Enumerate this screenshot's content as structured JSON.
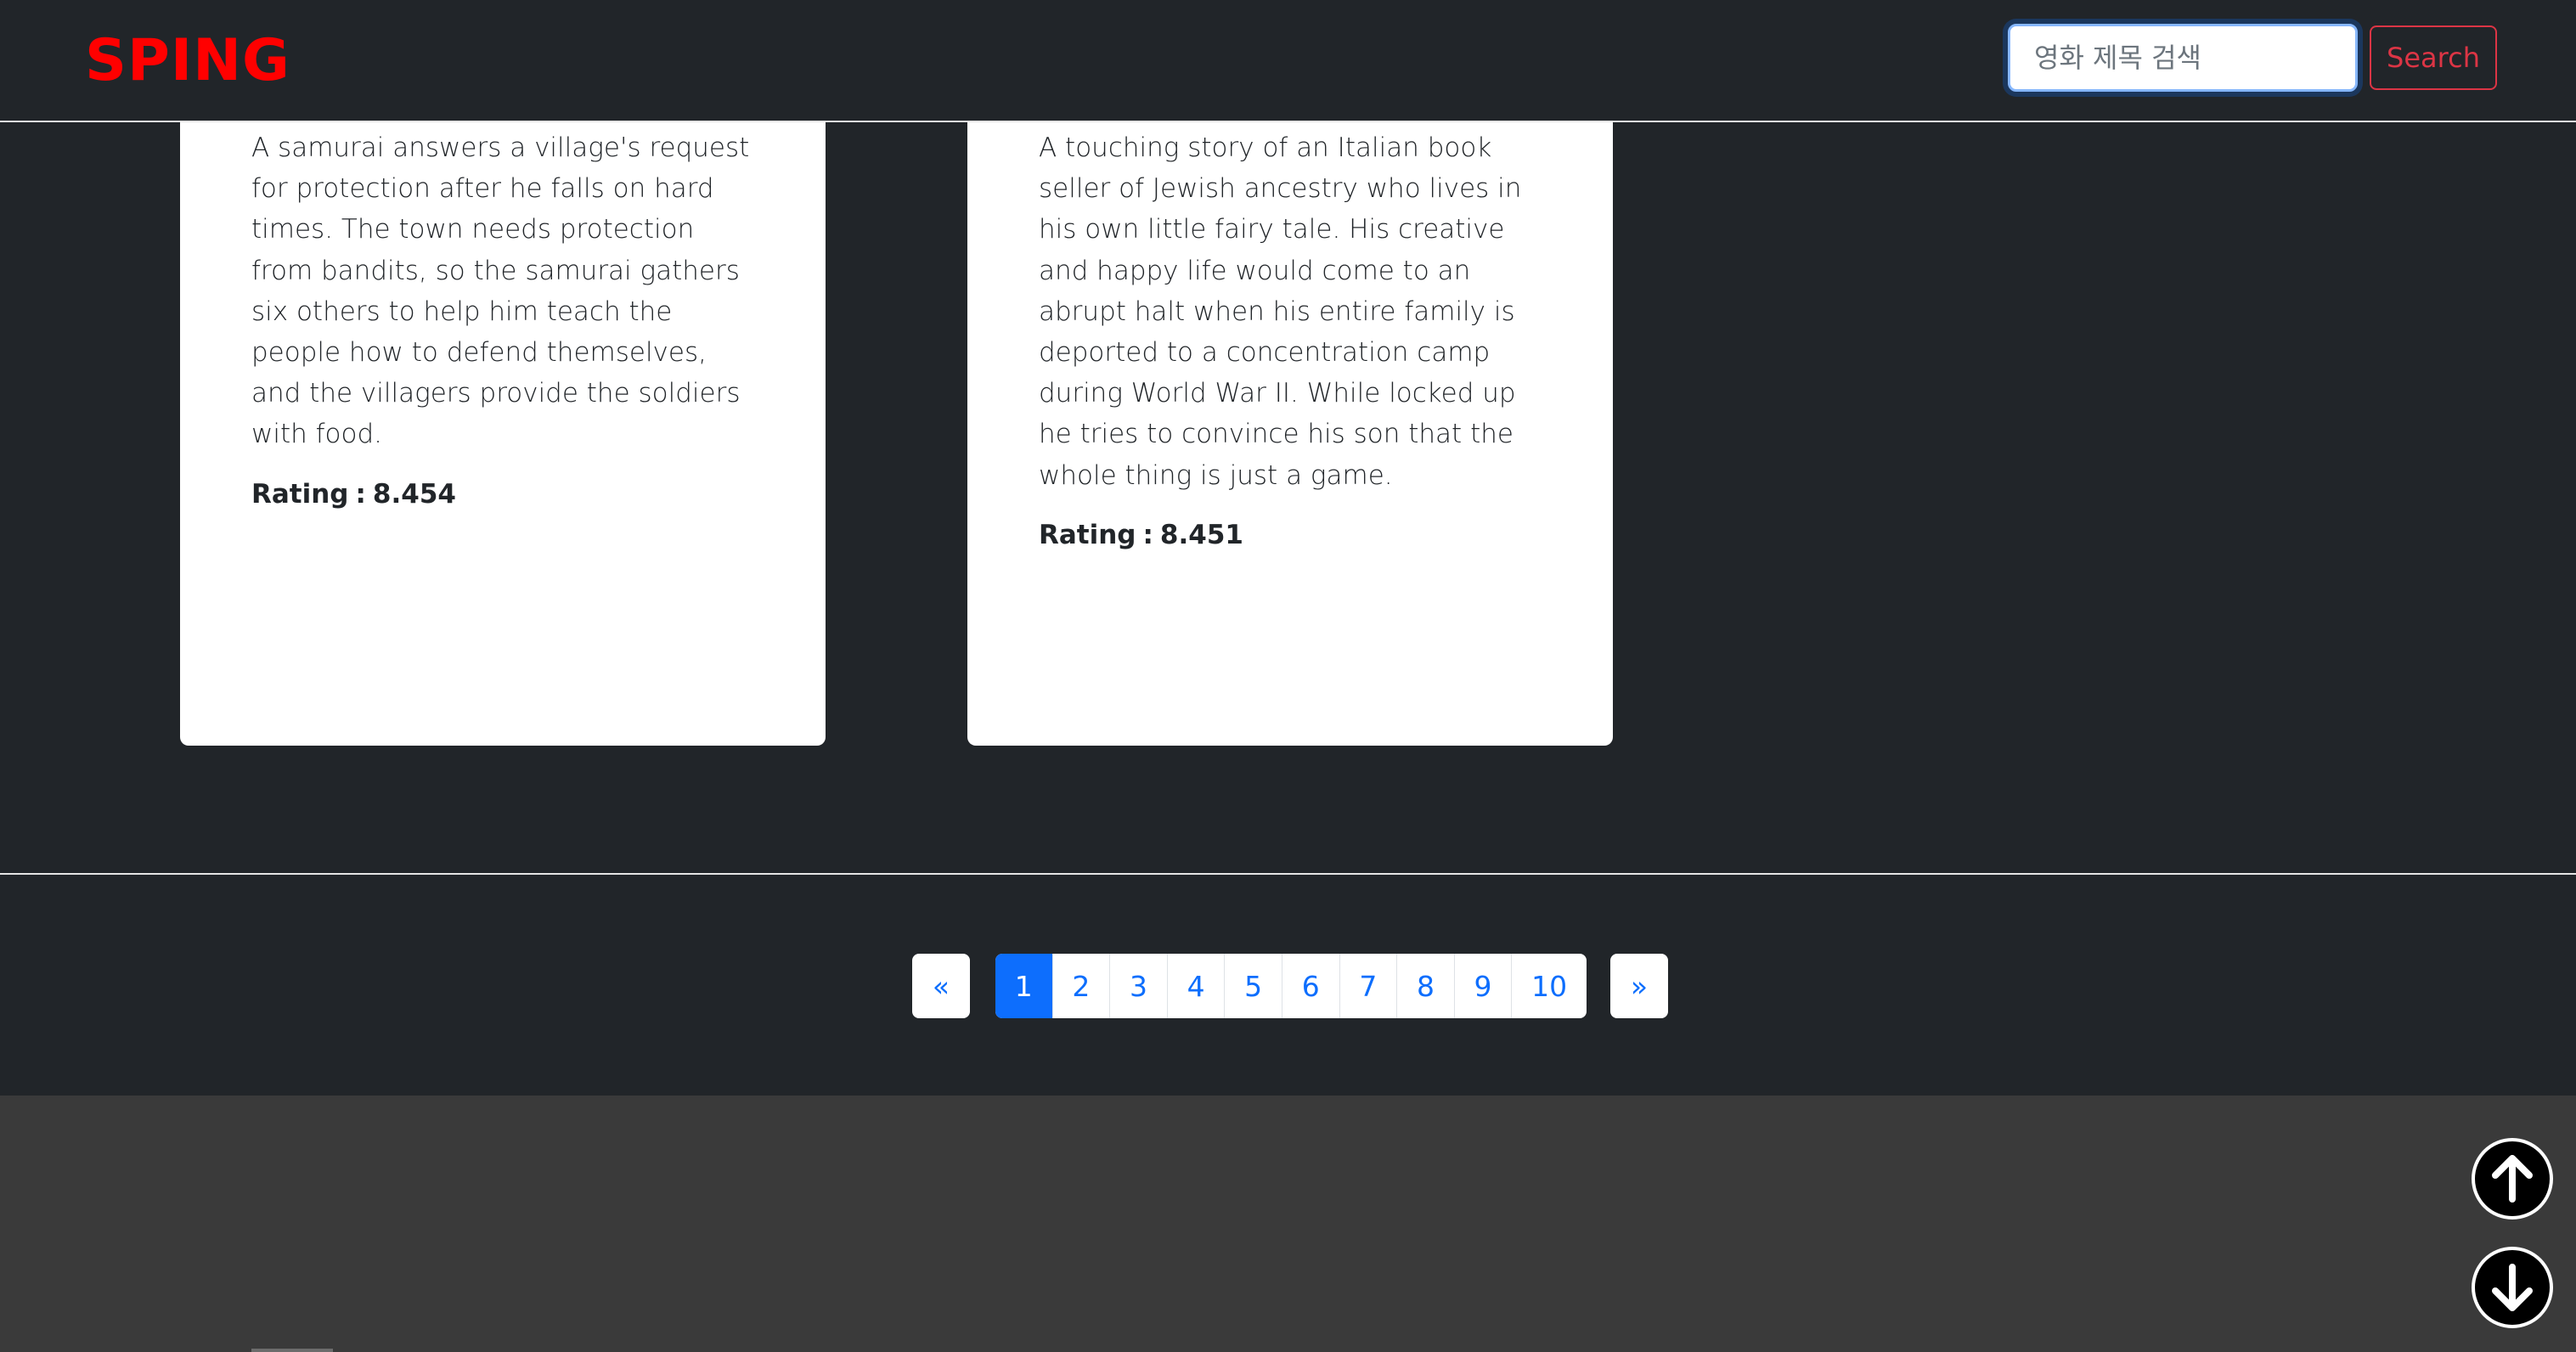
{
  "navbar": {
    "brand": "SPING",
    "search_placeholder": "영화 제목 검색",
    "search_value": "",
    "search_button": "Search"
  },
  "movies": [
    {
      "overview": "A samurai answers a village's request for protection after he falls on hard times. The town needs protection from bandits, so the samurai gathers six others to help him teach the people how to defend themselves, and the villagers provide the soldiers with food.",
      "rating_label": "Rating",
      "rating_value": "8.454"
    },
    {
      "overview": "A touching story of an Italian book seller of Jewish ancestry who lives in his own little fairy tale. His creative and happy life would come to an abrupt halt when his entire family is deported to a concentration camp during World War II. While locked up he tries to convince his son that the whole thing is just a game.",
      "rating_label": "Rating",
      "rating_value": "8.451"
    }
  ],
  "pagination": {
    "prev": "«",
    "next": "»",
    "pages": [
      "1",
      "2",
      "3",
      "4",
      "5",
      "6",
      "7",
      "8",
      "9",
      "10"
    ],
    "current": "1"
  },
  "scroll_buttons": {
    "up_icon": "arrow-up-circle-icon",
    "down_icon": "arrow-down-circle-icon"
  }
}
